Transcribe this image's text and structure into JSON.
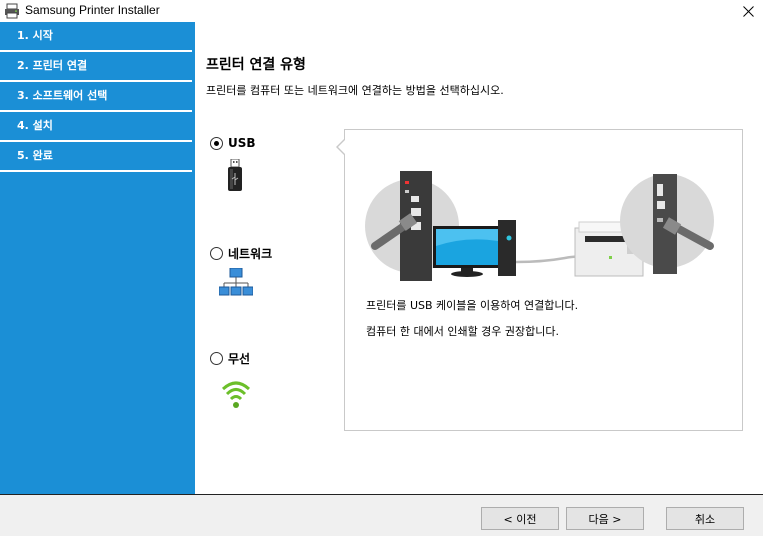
{
  "window": {
    "title": "Samsung Printer Installer",
    "close_icon": "close-icon"
  },
  "sidebar": {
    "steps": [
      {
        "label": "1. 시작"
      },
      {
        "label": "2. 프린터 연결"
      },
      {
        "label": "3. 소프트웨어 선택"
      },
      {
        "label": "4. 설치"
      },
      {
        "label": "5. 완료"
      }
    ],
    "active_index": 1
  },
  "main": {
    "title": "프린터 연결 유형",
    "description": "프린터를 컴퓨터 또는 네트워크에 연결하는 방법을 선택하십시오.",
    "options": [
      {
        "label": "USB",
        "selected": true,
        "icon": "usb-icon"
      },
      {
        "label": "네트워크",
        "selected": false,
        "icon": "network-icon"
      },
      {
        "label": "무선",
        "selected": false,
        "icon": "wireless-icon"
      }
    ],
    "info": {
      "line1": "프린터를 USB 케이블을 이용하여 연결합니다.",
      "line2": "컴퓨터 한 대에서 인쇄할 경우 권장합니다."
    }
  },
  "footer": {
    "back": "< 이전",
    "next": "다음 >",
    "cancel": "취소"
  },
  "colors": {
    "sidebar": "#1b8fd6",
    "accent_green": "#6cbf2a"
  }
}
